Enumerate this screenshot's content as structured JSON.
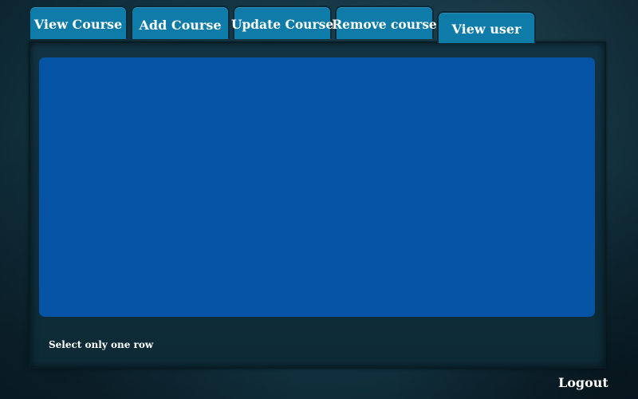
{
  "tabs": {
    "view_course": "View Course",
    "add_course": "Add Course",
    "update_course": "Update Course",
    "remove_course": "Remove course",
    "view_user": "View user"
  },
  "main": {
    "hint": "Select only one row"
  },
  "footer": {
    "logout": "Logout"
  },
  "colors": {
    "tab_bg": "#0f7ba8",
    "table_bg": "#0553a5",
    "background": "#143746",
    "text": "#ffffff"
  }
}
